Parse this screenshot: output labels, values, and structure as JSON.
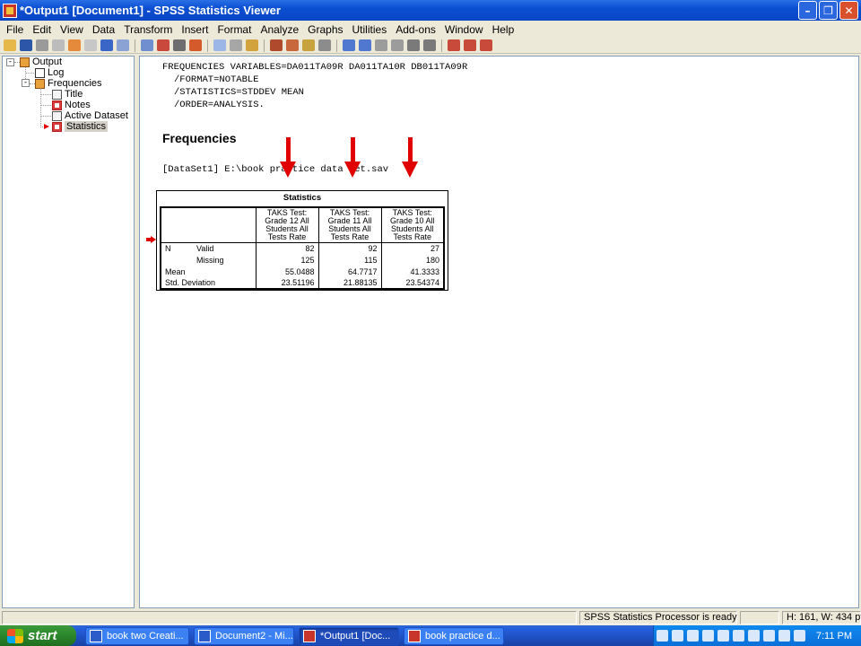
{
  "window": {
    "title": "*Output1 [Document1] - SPSS Statistics Viewer",
    "minimize_icon": "minimize-icon",
    "maximize_icon": "maximize-icon",
    "close_icon": "close-icon"
  },
  "menu": [
    "File",
    "Edit",
    "View",
    "Data",
    "Transform",
    "Insert",
    "Format",
    "Analyze",
    "Graphs",
    "Utilities",
    "Add-ons",
    "Window",
    "Help"
  ],
  "tree": {
    "root": "Output",
    "log": "Log",
    "frequencies": "Frequencies",
    "title": "Title",
    "notes": "Notes",
    "active_dataset": "Active Dataset",
    "statistics": "Statistics"
  },
  "syntax": {
    "line1": "FREQUENCIES VARIABLES=DA011TA09R DA011TA10R DB011TA09R",
    "line2": "/FORMAT=NOTABLE",
    "line3": "/STATISTICS=STDDEV MEAN",
    "line4": "/ORDER=ANALYSIS."
  },
  "heading": "Frequencies",
  "dataset": "[DataSet1] E:\\book practice data set.sav",
  "stats": {
    "title": "Statistics",
    "columns": [
      {
        "line1": "TAKS Test:",
        "line2": "Grade 12 All",
        "line3": "Students All",
        "line4": "Tests Rate"
      },
      {
        "line1": "TAKS Test:",
        "line2": "Grade 11 All",
        "line3": "Students All",
        "line4": "Tests Rate"
      },
      {
        "line1": "TAKS Test:",
        "line2": "Grade 10 All",
        "line3": "Students All",
        "line4": "Tests Rate"
      }
    ],
    "rows": {
      "n_label": "N",
      "valid_label": "Valid",
      "missing_label": "Missing",
      "mean_label": "Mean",
      "sd_label": "Std. Deviation",
      "valid": [
        "82",
        "92",
        "27"
      ],
      "missing": [
        "125",
        "115",
        "180"
      ],
      "mean": [
        "55.0488",
        "64.7717",
        "41.3333"
      ],
      "sd": [
        "23.51196",
        "21.88135",
        "23.54374"
      ]
    }
  },
  "status": {
    "processor": "SPSS Statistics  Processor is ready",
    "size": "H: 161, W: 434 pt."
  },
  "taskbar": {
    "start": "start",
    "tasks": [
      "book two Creati...",
      "Document2 - Mi...",
      "*Output1 [Doc...",
      "book practice d..."
    ],
    "clock": "7:11 PM"
  },
  "colors": {
    "accent_arrow": "#e00000",
    "title_bar": "#0a4fd1",
    "taskbar": "#245edb"
  }
}
